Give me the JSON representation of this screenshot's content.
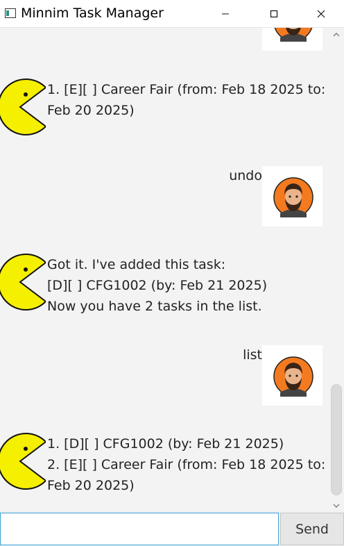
{
  "window": {
    "title": "Minnim Task Manager",
    "min_glyph": "—",
    "max_glyph": "☐",
    "close_glyph": "✕"
  },
  "messages": [
    {
      "sender": "user",
      "text": ""
    },
    {
      "sender": "bot",
      "lines": [
        "1. [E][ ] Career Fair (from: Feb 18 2025 to:",
        "Feb 20 2025)"
      ]
    },
    {
      "sender": "user",
      "text": "undo"
    },
    {
      "sender": "bot",
      "lines": [
        "Got it. I've added this task:",
        "[D][ ] CFG1002 (by: Feb 21 2025)",
        "Now you have 2 tasks in the list."
      ]
    },
    {
      "sender": "user",
      "text": "list"
    },
    {
      "sender": "bot",
      "lines": [
        "1. [D][ ] CFG1002 (by: Feb 21 2025)",
        "2. [E][ ] Career Fair (from: Feb 18 2025 to:",
        "Feb 20 2025)"
      ]
    }
  ],
  "input": {
    "value": "",
    "placeholder": ""
  },
  "send_label": "Send",
  "icons": {
    "bot_avatar": "pacman-icon",
    "user_avatar": "bearded-man-avatar-icon"
  },
  "colors": {
    "pacman": "#f5ef00",
    "avatar_bg": "#f47a20",
    "input_border": "#38a3d8"
  }
}
